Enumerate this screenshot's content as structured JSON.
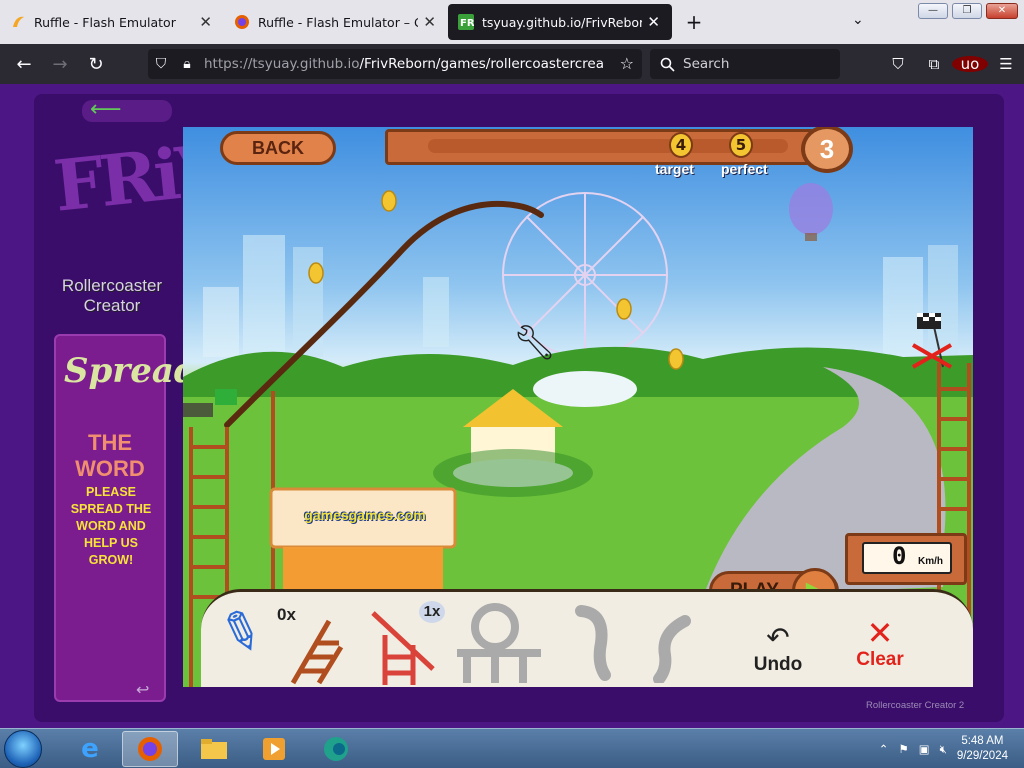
{
  "browser": {
    "tabs": [
      {
        "label": "Ruffle - Flash Emulator",
        "icon": "ruffle-icon",
        "active": false
      },
      {
        "label": "Ruffle - Flash Emulator – Get the",
        "icon": "firefox-icon",
        "active": false
      },
      {
        "label": "tsyuay.github.io/FrivReborn/ga",
        "icon": "friv-icon",
        "active": true
      }
    ],
    "url_host": "https://tsyuay.github.io",
    "url_path": "/FrivReborn/games/rollercoastercreator/fr",
    "search_placeholder": "Search"
  },
  "sidebar": {
    "game_title_line1": "Rollercoaster",
    "game_title_line2": "Creator",
    "spread_title": "Spread",
    "spread_word": "THE WORD",
    "spread_message_lines": [
      "PLEASE",
      "SPREAD THE",
      "WORD AND",
      "HELP US",
      "GROW!"
    ]
  },
  "game": {
    "back_label": "BACK",
    "target_value": "4",
    "target_label": "target",
    "perfect_value": "5",
    "perfect_label": "perfect",
    "level": "3",
    "billboard_text": "gamesgames.com",
    "play_label": "PLAY",
    "speed_value": "0",
    "speed_unit": "Km/h",
    "tool_track_count": "0x",
    "tool_support_count": "1x",
    "undo_label": "Undo",
    "clear_label": "Clear",
    "colors": {
      "clear": "#e3221b",
      "coin": "#f3c531",
      "track": "#5a2a10",
      "panel": "#f1ede2"
    }
  },
  "footer_credit": "Rollercoaster Creator 2",
  "taskbar": {
    "apps": [
      "internet-explorer-icon",
      "firefox-icon",
      "file-explorer-icon",
      "media-player-icon",
      "edge-icon"
    ],
    "time": "5:48 AM",
    "date": "9/29/2024"
  }
}
